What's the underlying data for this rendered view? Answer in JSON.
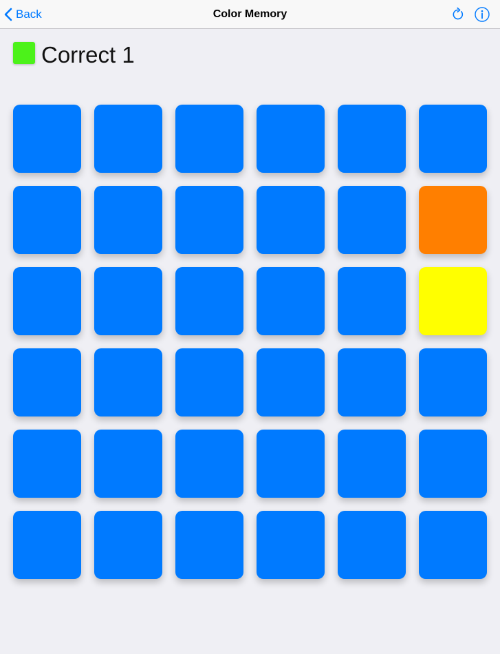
{
  "navbar": {
    "back_label": "Back",
    "title": "Color Memory",
    "refresh_icon": "refresh-icon",
    "info_icon": "info-icon",
    "tint": "#007aff"
  },
  "status": {
    "text": "Correct 1",
    "swatch_color": "#4cf21a"
  },
  "board": {
    "rows": 6,
    "columns": 6,
    "tiles": [
      [
        "#007aff",
        "#007aff",
        "#007aff",
        "#007aff",
        "#007aff",
        "#007aff"
      ],
      [
        "#007aff",
        "#007aff",
        "#007aff",
        "#007aff",
        "#007aff",
        "#ff7f00"
      ],
      [
        "#007aff",
        "#007aff",
        "#007aff",
        "#007aff",
        "#007aff",
        "#ffff00"
      ],
      [
        "#007aff",
        "#007aff",
        "#007aff",
        "#007aff",
        "#007aff",
        "#007aff"
      ],
      [
        "#007aff",
        "#007aff",
        "#007aff",
        "#007aff",
        "#007aff",
        "#007aff"
      ],
      [
        "#007aff",
        "#007aff",
        "#007aff",
        "#007aff",
        "#007aff",
        "#007aff"
      ]
    ]
  }
}
